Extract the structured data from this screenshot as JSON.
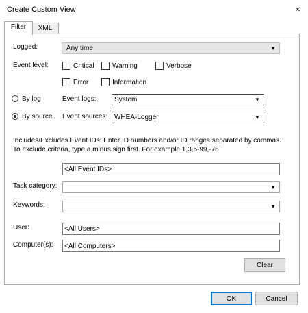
{
  "window": {
    "title": "Create Custom View",
    "close_icon": "×"
  },
  "tabs": [
    {
      "label": "Filter",
      "active": true
    },
    {
      "label": "XML",
      "active": false
    }
  ],
  "filter": {
    "logged_label": "Logged:",
    "logged_value": "Any time",
    "event_level_label": "Event level:",
    "levels": [
      {
        "label": "Critical",
        "checked": false
      },
      {
        "label": "Warning",
        "checked": false
      },
      {
        "label": "Verbose",
        "checked": false
      },
      {
        "label": "Error",
        "checked": false
      },
      {
        "label": "Information",
        "checked": false
      }
    ],
    "by_log_label": "By log",
    "by_source_label": "By source",
    "selected_mode": "by_source",
    "event_logs_label": "Event logs:",
    "event_logs_value": "System",
    "event_sources_label": "Event sources:",
    "event_sources_value": "WHEA-Logger",
    "event_ids_help": "Includes/Excludes Event IDs: Enter ID numbers and/or ID ranges separated by commas. To exclude criteria, type a minus sign first. For example 1,3,5-99,-76",
    "event_ids_value": "<All Event IDs>",
    "task_category_label": "Task category:",
    "task_category_value": "",
    "keywords_label": "Keywords:",
    "keywords_value": "",
    "user_label": "User:",
    "user_value": "<All Users>",
    "computer_label": "Computer(s):",
    "computer_value": "<All Computers>",
    "clear_label": "Clear"
  },
  "footer": {
    "ok_label": "OK",
    "cancel_label": "Cancel"
  },
  "colors": {
    "accent": "#0078d7",
    "button_bg": "#e1e1e1",
    "disabled_bg": "#e5e5e5"
  }
}
